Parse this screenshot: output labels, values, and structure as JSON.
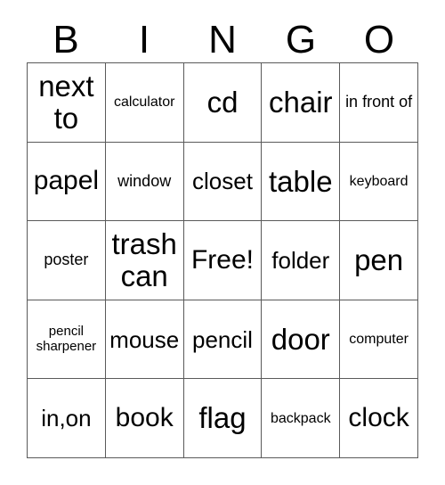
{
  "card": {
    "title_letters": [
      "B",
      "I",
      "N",
      "G",
      "O"
    ],
    "columns": [
      "B",
      "I",
      "N",
      "G",
      "O"
    ],
    "rows": [
      [
        {
          "text": "next to",
          "size": "xl"
        },
        {
          "text": "calculator",
          "size": "xs"
        },
        {
          "text": "cd",
          "size": "xl"
        },
        {
          "text": "chair",
          "size": "xl"
        },
        {
          "text": "in front of",
          "size": "sm"
        }
      ],
      [
        {
          "text": "papel",
          "size": "lg"
        },
        {
          "text": "window",
          "size": "sm"
        },
        {
          "text": "closet",
          "size": "md"
        },
        {
          "text": "table",
          "size": "xl"
        },
        {
          "text": "keyboard",
          "size": "xs"
        }
      ],
      [
        {
          "text": "poster",
          "size": "sm"
        },
        {
          "text": "trash can",
          "size": "xl"
        },
        {
          "text": "Free!",
          "size": "lg"
        },
        {
          "text": "folder",
          "size": "md"
        },
        {
          "text": "pen",
          "size": "xl"
        }
      ],
      [
        {
          "text": "pencil sharpener",
          "size": "xxs"
        },
        {
          "text": "mouse",
          "size": "md"
        },
        {
          "text": "pencil",
          "size": "md"
        },
        {
          "text": "door",
          "size": "xl"
        },
        {
          "text": "computer",
          "size": "xs"
        }
      ],
      [
        {
          "text": "in,on",
          "size": "md"
        },
        {
          "text": "book",
          "size": "lg"
        },
        {
          "text": "flag",
          "size": "xl"
        },
        {
          "text": "backpack",
          "size": "xs"
        },
        {
          "text": "clock",
          "size": "lg"
        }
      ]
    ]
  },
  "colors": {
    "background": "#ffffff",
    "text": "#000000",
    "border": "#5a5a5a"
  }
}
